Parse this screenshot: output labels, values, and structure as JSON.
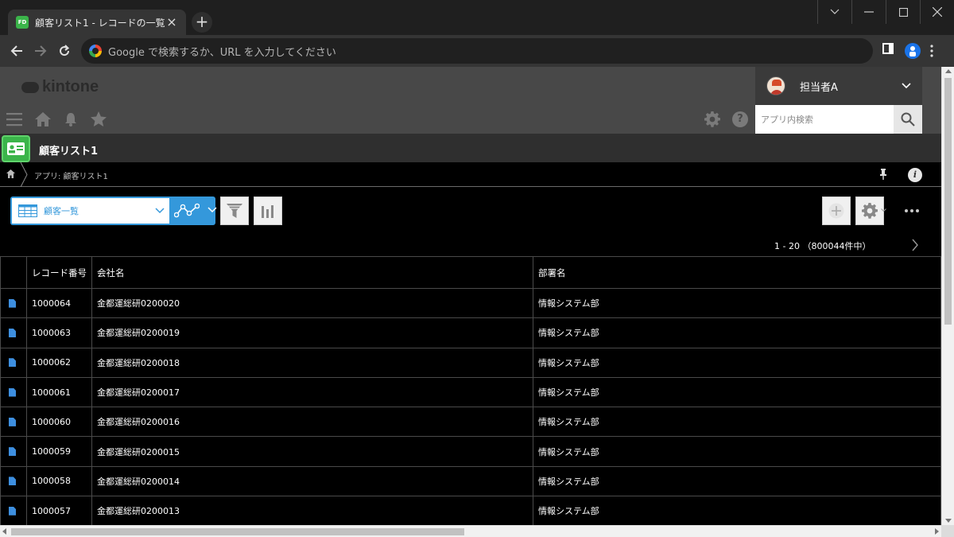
{
  "browser": {
    "tab_title": "顧客リスト1 - レコードの一覧",
    "favicon_text": "FD",
    "omnibox_placeholder": "Google で検索するか、URL を入力してください"
  },
  "kintone": {
    "logo": "kintone",
    "user_name": "担当者A",
    "search_placeholder": "アプリ内検索",
    "app_name": "顧客リスト1",
    "breadcrumb": "アプリ: 顧客リスト1"
  },
  "toolbar": {
    "view_name": "顧客一覧",
    "pagination": "1 - 20 （800044件中）"
  },
  "colors": {
    "accent": "#3498db",
    "app_icon": "#3bb44a",
    "record_icon": "#3d8fe0"
  },
  "table": {
    "headers": [
      "レコード番号",
      "会社名",
      "部署名"
    ],
    "rows": [
      [
        "1000064",
        "金都運総研0200020",
        "情報システム部"
      ],
      [
        "1000063",
        "金都運総研0200019",
        "情報システム部"
      ],
      [
        "1000062",
        "金都運総研0200018",
        "情報システム部"
      ],
      [
        "1000061",
        "金都運総研0200017",
        "情報システム部"
      ],
      [
        "1000060",
        "金都運総研0200016",
        "情報システム部"
      ],
      [
        "1000059",
        "金都運総研0200015",
        "情報システム部"
      ],
      [
        "1000058",
        "金都運総研0200014",
        "情報システム部"
      ],
      [
        "1000057",
        "金都運総研0200013",
        "情報システム部"
      ]
    ]
  }
}
